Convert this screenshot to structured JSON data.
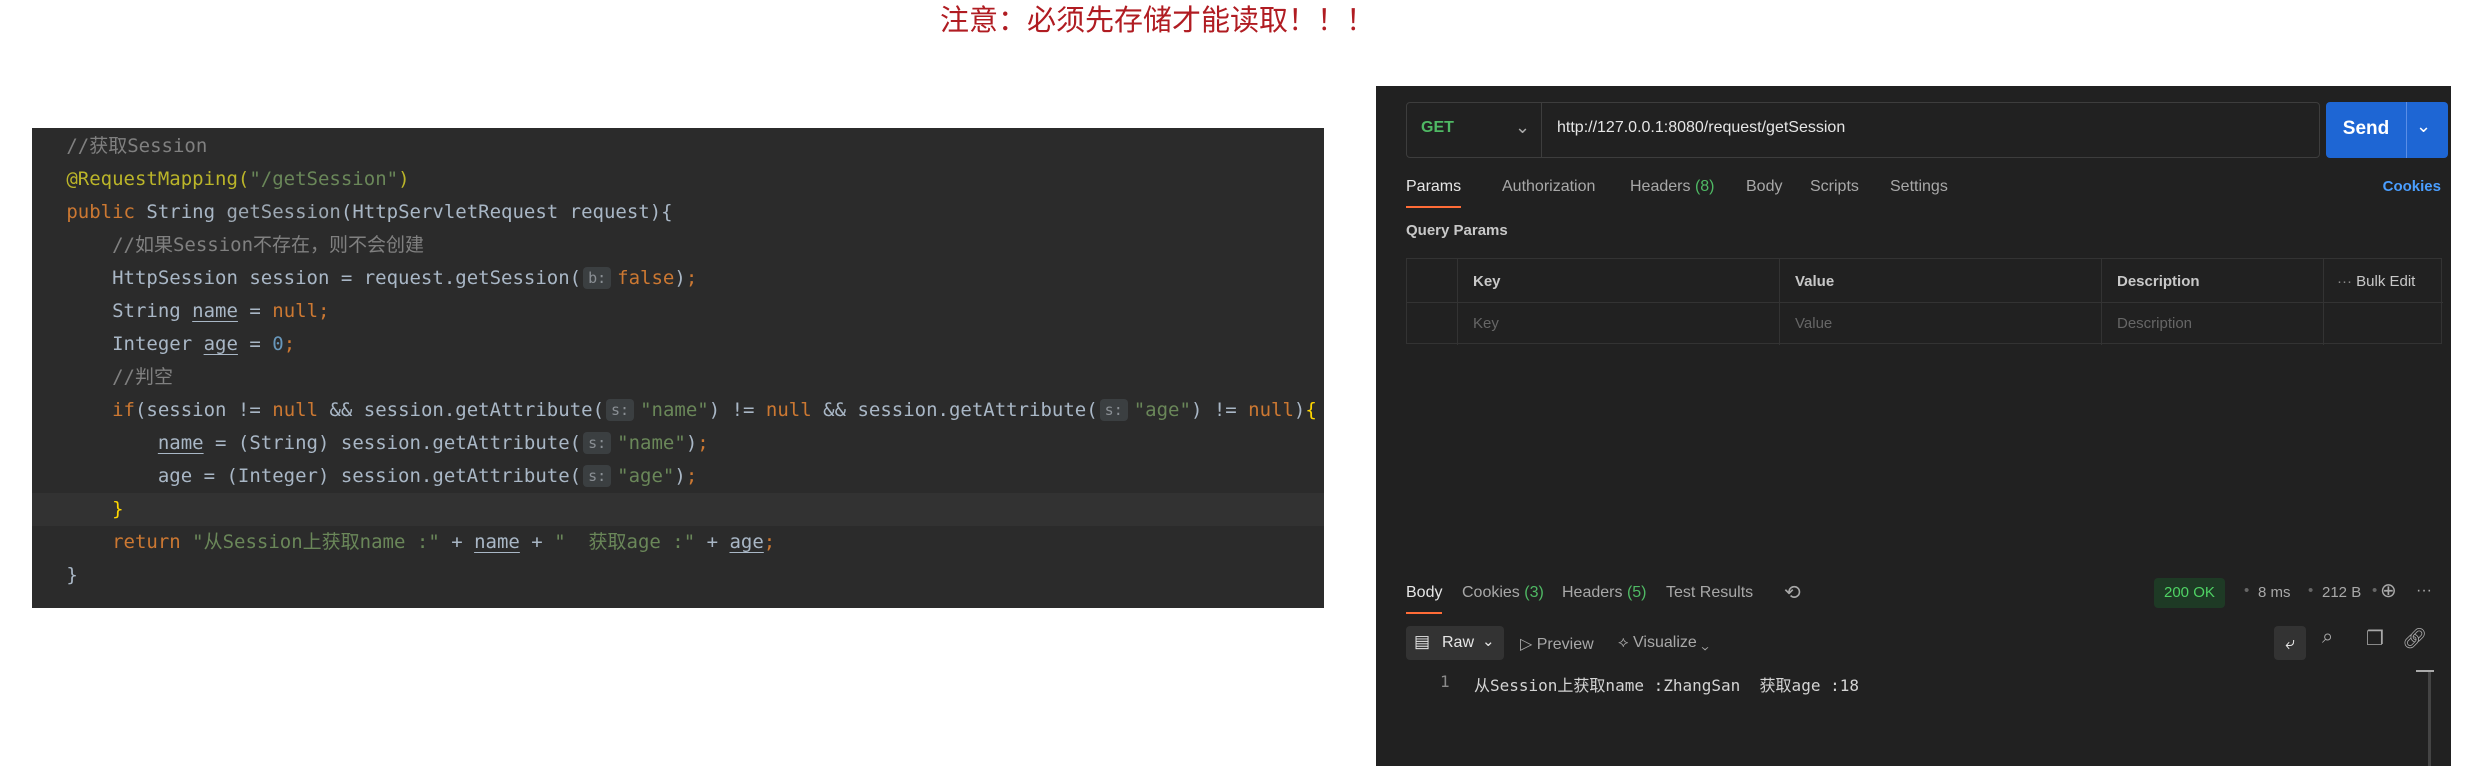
{
  "notice": "注意：必须先存储才能读取！！！",
  "code": {
    "lines": [
      [
        {
          "c": "c-com",
          "t": "//获取Session"
        }
      ],
      [
        {
          "c": "c-ann",
          "t": "@RequestMapping("
        },
        {
          "c": "c-str",
          "t": "\"/getSession\""
        },
        {
          "c": "c-ann",
          "t": ")"
        }
      ],
      [
        {
          "c": "c-kw",
          "t": "public "
        },
        {
          "c": "",
          "t": "String "
        },
        {
          "c": "c-fn",
          "t": "getSession"
        },
        {
          "c": "",
          "t": "(HttpServletRequest request){"
        }
      ],
      [
        {
          "c": "",
          "t": "    "
        },
        {
          "c": "c-com",
          "t": "//如果Session不存在，则不会创建"
        }
      ],
      [
        {
          "c": "",
          "t": "    HttpSession session = request.getSession("
        },
        {
          "c": "c-hint",
          "t": "b:"
        },
        {
          "c": "c-kw",
          "t": "false"
        },
        {
          "c": "",
          "t": ")"
        },
        {
          "c": "c-kw",
          "t": ";"
        }
      ],
      [
        {
          "c": "",
          "t": "    String "
        },
        {
          "c": "c-var",
          "t": "name"
        },
        {
          "c": "",
          "t": " = "
        },
        {
          "c": "c-kw",
          "t": "null;"
        }
      ],
      [
        {
          "c": "",
          "t": "    Integer "
        },
        {
          "c": "c-var",
          "t": "age"
        },
        {
          "c": "",
          "t": " = "
        },
        {
          "c": "c-num",
          "t": "0"
        },
        {
          "c": "c-kw",
          "t": ";"
        }
      ],
      [
        {
          "c": "",
          "t": "    "
        },
        {
          "c": "c-com",
          "t": "//判空"
        }
      ],
      [
        {
          "c": "",
          "t": "    "
        },
        {
          "c": "c-kw",
          "t": "if"
        },
        {
          "c": "",
          "t": "(session != "
        },
        {
          "c": "c-kw",
          "t": "null"
        },
        {
          "c": "",
          "t": " && session.getAttribute("
        },
        {
          "c": "c-hint",
          "t": "s:"
        },
        {
          "c": "c-str",
          "t": "\"name\""
        },
        {
          "c": "",
          "t": ") != "
        },
        {
          "c": "c-kw",
          "t": "null"
        },
        {
          "c": "",
          "t": " && session.getAttribute("
        },
        {
          "c": "c-hint",
          "t": "s:"
        },
        {
          "c": "c-str",
          "t": "\"age\""
        },
        {
          "c": "",
          "t": ") != "
        },
        {
          "c": "c-kw",
          "t": "null"
        },
        {
          "c": "",
          "t": ")"
        },
        {
          "c": "c-brace",
          "t": "{"
        }
      ],
      [
        {
          "c": "",
          "t": "        "
        },
        {
          "c": "c-var",
          "t": "name"
        },
        {
          "c": "",
          "t": " = (String) session.getAttribute("
        },
        {
          "c": "c-hint",
          "t": "s:"
        },
        {
          "c": "c-str",
          "t": "\"name\""
        },
        {
          "c": "",
          "t": ")"
        },
        {
          "c": "c-kw",
          "t": ";"
        }
      ],
      [
        {
          "c": "",
          "t": "        age = (Integer) session.getAttribute("
        },
        {
          "c": "c-hint",
          "t": "s:"
        },
        {
          "c": "c-str",
          "t": "\"age\""
        },
        {
          "c": "",
          "t": ")"
        },
        {
          "c": "c-kw",
          "t": ";"
        }
      ],
      [
        {
          "c": "",
          "t": "    "
        },
        {
          "c": "c-brace",
          "t": "}"
        }
      ],
      [
        {
          "c": "",
          "t": "    "
        },
        {
          "c": "c-kw",
          "t": "return "
        },
        {
          "c": "c-str",
          "t": "\"从Session上获取name :\""
        },
        {
          "c": "",
          "t": " + "
        },
        {
          "c": "c-var",
          "t": "name"
        },
        {
          "c": "",
          "t": " + "
        },
        {
          "c": "c-str",
          "t": "\"  获取age :\""
        },
        {
          "c": "",
          "t": " + "
        },
        {
          "c": "c-var",
          "t": "age"
        },
        {
          "c": "c-kw",
          "t": ";"
        }
      ],
      [
        {
          "c": "",
          "t": "}"
        }
      ]
    ],
    "highlight_line": 11
  },
  "postman": {
    "method": "GET",
    "url": "http://127.0.0.1:8080/request/getSession",
    "send_label": "Send",
    "tabs": {
      "params": "Params",
      "authorization": "Authorization",
      "headers": "Headers",
      "headers_count": "(8)",
      "body": "Body",
      "scripts": "Scripts",
      "settings": "Settings"
    },
    "cookies_link": "Cookies",
    "query_params_title": "Query Params",
    "table": {
      "headers": [
        "Key",
        "Value",
        "Description"
      ],
      "placeholders": [
        "Key",
        "Value",
        "Description"
      ],
      "bulk_edit": "Bulk Edit"
    },
    "response": {
      "tabs": {
        "body": "Body",
        "cookies": "Cookies",
        "cookies_count": "(3)",
        "headers": "Headers",
        "headers_count": "(5)",
        "test_results": "Test Results"
      },
      "status": "200 OK",
      "time": "8 ms",
      "size": "212 B",
      "format": "Raw",
      "preview": "Preview",
      "visualize": "Visualize",
      "line_number": "1",
      "body": "从Session上获取name :ZhangSan  获取age :18"
    }
  },
  "icons": {
    "chevron": "chevron-down-icon",
    "history": "history-icon",
    "globe": "globe-icon",
    "more": "more-icon",
    "search": "search-icon",
    "copy": "copy-icon",
    "link": "link-icon",
    "wrap": "wrap-icon"
  }
}
